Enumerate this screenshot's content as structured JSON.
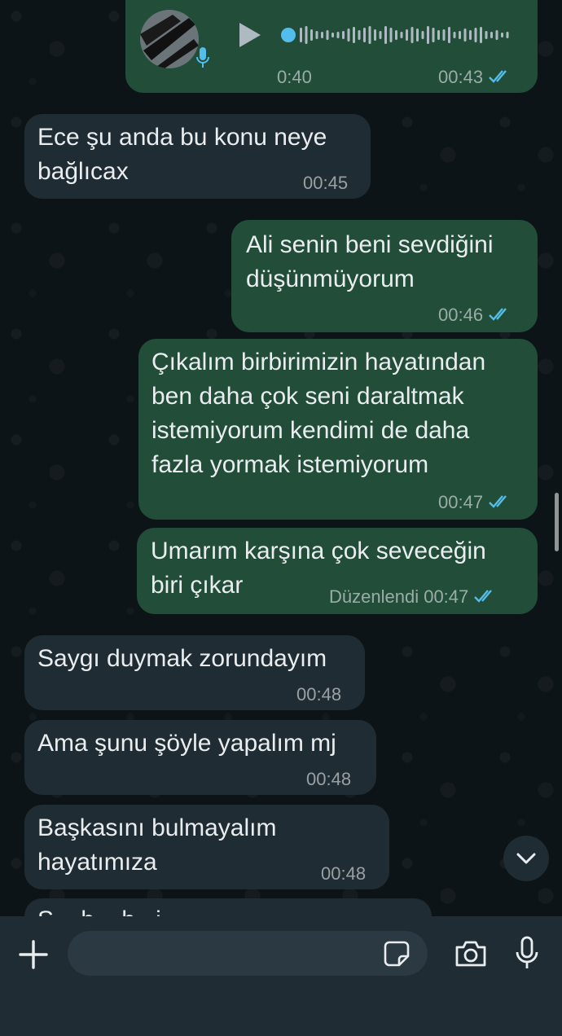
{
  "voice_message": {
    "duration": "0:40",
    "time": "00:43"
  },
  "messages": [
    {
      "line1": "Ece şu anda bu konu neye",
      "line2": "bağlıcax",
      "time": "00:45"
    },
    {
      "line1": "Ali senin beni sevdiğini",
      "line2": "düşünmüyorum",
      "time": "00:46"
    },
    {
      "line1": "Çıkalım birbirimizin hayatından",
      "line2": "ben daha çok seni daraltmak",
      "line3": "istemiyorum kendimi de daha",
      "line4": "fazla yormak istemiyorum",
      "time": "00:47"
    },
    {
      "line1": "Umarım karşına çok seveceğin",
      "line2": "biri çıkar",
      "edited": "Düzenlendi",
      "time": "00:47"
    },
    {
      "line1": "Saygı duymak zorundayım",
      "time": "00:48"
    },
    {
      "line1": "Ama şunu şöyle yapalım mj",
      "time": "00:48"
    },
    {
      "line1": "Başkasını bulmayalım",
      "line2": "hayatımıza",
      "time": "00:48"
    }
  ],
  "partial_message": "Ş... b... b...i...",
  "composer": {
    "placeholder": ""
  },
  "colors": {
    "incoming_bubble": "#202c33",
    "outgoing_bubble": "#214d39",
    "read_ticks": "#53bdeb"
  }
}
